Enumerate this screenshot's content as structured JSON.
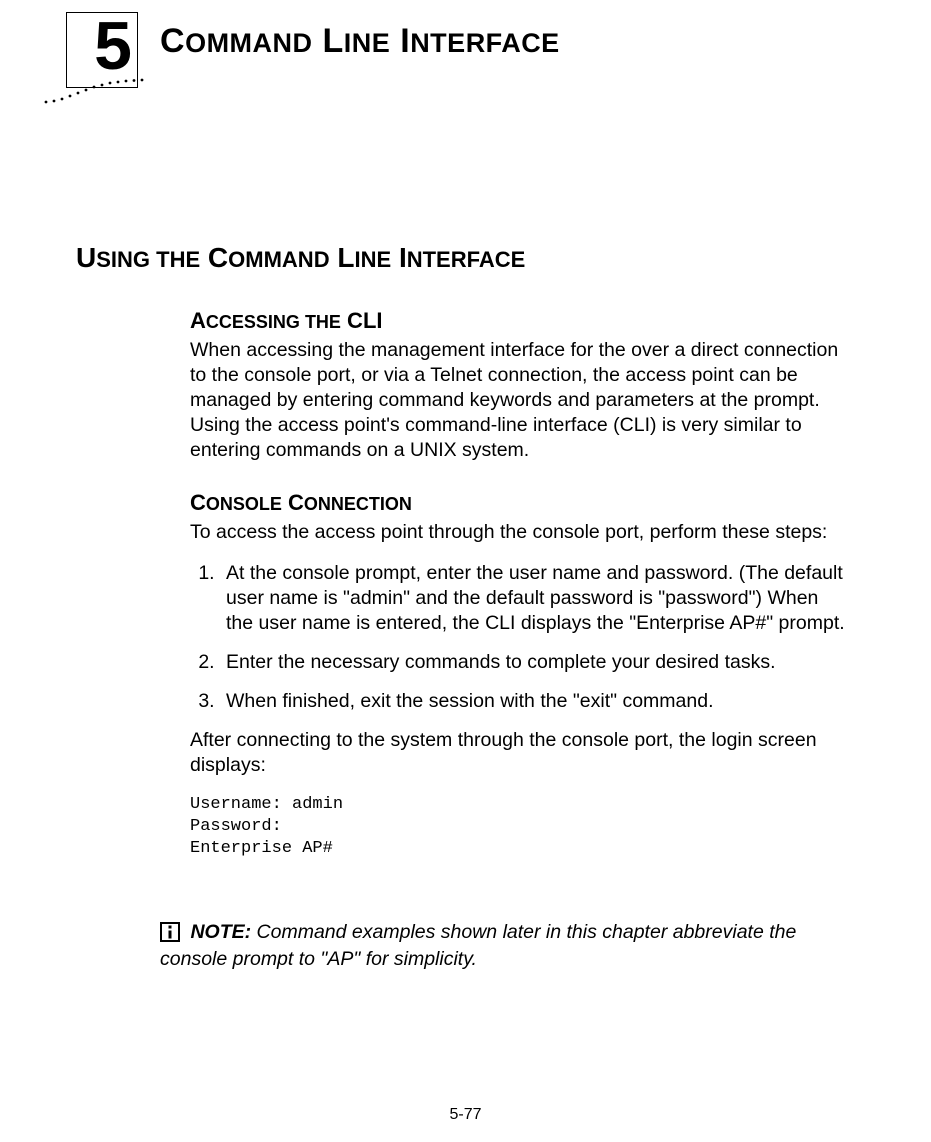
{
  "chapter": {
    "number": "5",
    "title_parts": [
      "C",
      "OMMAND",
      " L",
      "INE",
      " I",
      "NTERFACE"
    ]
  },
  "section": {
    "title_parts": [
      "U",
      "SING",
      " ",
      "THE",
      " C",
      "OMMAND",
      " L",
      "INE",
      " I",
      "NTERFACE"
    ]
  },
  "sub1": {
    "title_parts": [
      "A",
      "CCESSING",
      " ",
      "THE",
      " CLI"
    ],
    "para": "When accessing the management interface for the over a direct connection to the console port, or via a Telnet connection, the access point can be managed by entering command keywords and parameters at the prompt. Using the access point's command-line interface (CLI) is very similar to entering commands on a UNIX system."
  },
  "sub2": {
    "title_parts": [
      "C",
      "ONSOLE",
      " C",
      "ONNECTION"
    ],
    "intro": "To access the access point through the console port, perform these steps:",
    "steps": [
      "At the console prompt, enter the user name and password. (The default user name is \"admin\" and the default password is \"password\") When the user name is entered, the CLI displays the \"Enterprise AP#\" prompt.",
      "Enter the necessary commands to complete your desired tasks.",
      "When finished, exit the session with the \"exit\" command."
    ],
    "after": "After connecting to the system through the console port, the login screen displays:",
    "code": "Username: admin\nPassword: \nEnterprise AP#"
  },
  "note": {
    "label": "NOTE:",
    "text": " Command examples shown later in this chapter abbreviate the console prompt to \"AP\" for simplicity."
  },
  "page_number": "5-77"
}
